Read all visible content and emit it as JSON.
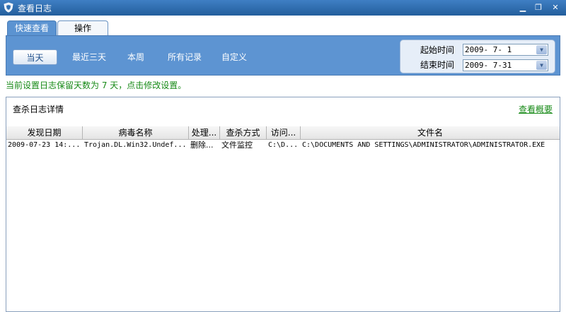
{
  "window": {
    "title": "查看日志",
    "minimize": "▁",
    "restore": "❐",
    "close": "✕"
  },
  "tabs": [
    {
      "label": "快速查看",
      "active": true
    },
    {
      "label": "操作",
      "active": false
    }
  ],
  "filters": {
    "today": "当天",
    "last3days": "最近三天",
    "week": "本周",
    "all": "所有记录",
    "custom": "自定义",
    "selected": "today"
  },
  "dates": {
    "start_label": "起始时间",
    "start_value": "2009- 7- 1",
    "end_label": "结束时间",
    "end_value": "2009- 7-31",
    "dropdown_glyph": "▼"
  },
  "note": "当前设置日志保留天数为 7 天，点击修改设置。",
  "log": {
    "heading": "查杀日志详情",
    "overview_link": "查看概要",
    "columns": [
      "发现日期",
      "病毒名称",
      "处理...",
      "查杀方式",
      "访问...",
      "文件名"
    ],
    "rows": [
      {
        "date": "2009-07-23 14:...",
        "virus": "Trojan.DL.Win32.Undef...",
        "action": "删除...",
        "method": "文件监控",
        "access": "C:\\D...",
        "file": "C:\\DOCUMENTS AND SETTINGS\\ADMINISTRATOR\\ADMINISTRATOR.EXE"
      }
    ]
  },
  "colors": {
    "titlebar": "#2f6fb2",
    "toolbar": "#5d94d2",
    "note_green": "#178a17"
  }
}
